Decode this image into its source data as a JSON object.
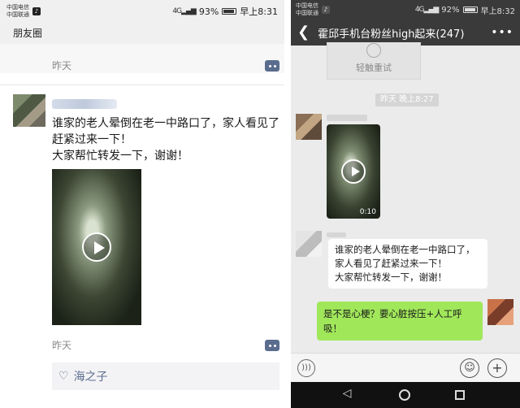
{
  "left": {
    "status": {
      "carrier1": "中国电信",
      "carrier2": "中国联通",
      "signal": "4G",
      "battery": "93%",
      "time": "早上8:31"
    },
    "title": "朋友圈",
    "prev_post": {
      "time": "昨天"
    },
    "post": {
      "text": "谁家的老人晕倒在老一中路口了，家人看见了赶紧过来一下！\n大家帮忙转发一下，谢谢！",
      "time": "昨天",
      "liker": "海之子"
    }
  },
  "right": {
    "status": {
      "carrier1": "中国电信",
      "carrier2": "中国联通",
      "signal": "4G",
      "battery": "92%",
      "time": "早上8:32"
    },
    "chat_title": "霍邱手机台粉丝high起来(247)",
    "retry_label": "轻触重试",
    "time_pill": "昨天 晚上8:27",
    "video_duration": "0:10",
    "msg_white": "谁家的老人晕倒在老一中路口了，家人看见了赶紧过来一下！\n大家帮忙转发一下，谢谢！",
    "msg_green": "是不是心梗？要心脏按压+人工呼吸！"
  },
  "colors": {
    "accent_link": "#5b6d8f",
    "bubble_green": "#a0e75a",
    "chat_header": "#3a3a3a"
  }
}
